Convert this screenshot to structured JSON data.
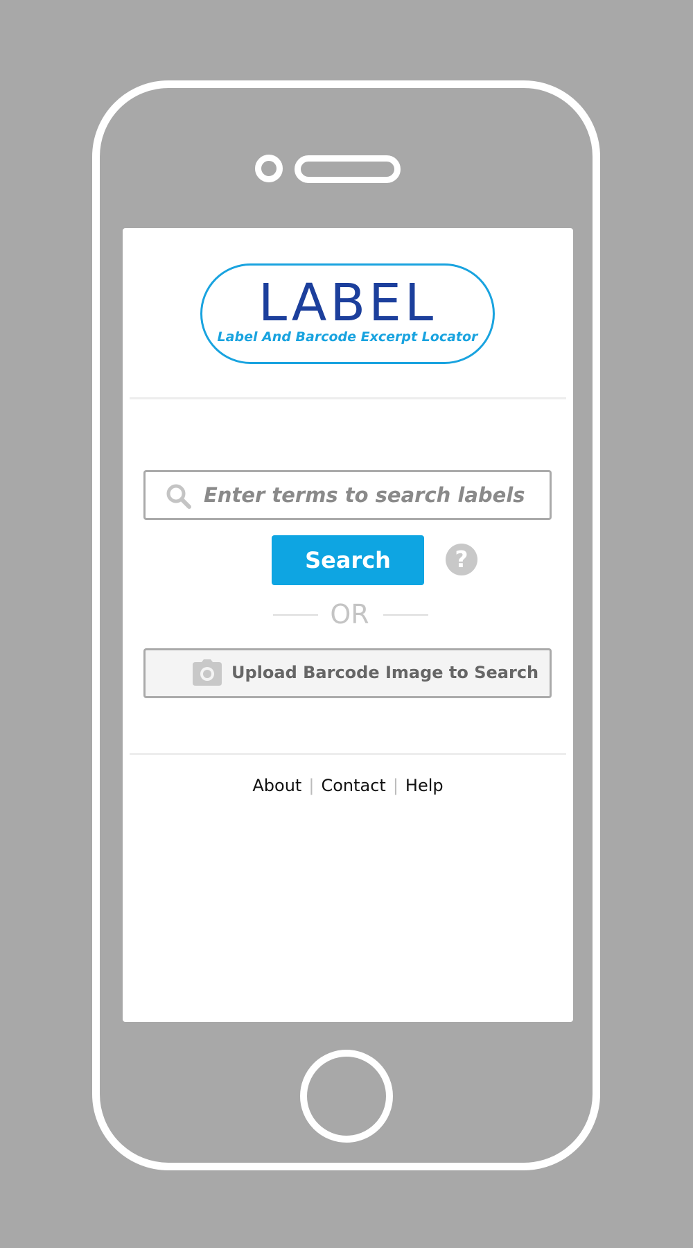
{
  "logo": {
    "title": "LABEL",
    "subtitle": "Label And Barcode Excerpt Locator"
  },
  "search": {
    "placeholder": "Enter terms to search labels",
    "value": "",
    "button_label": "Search",
    "help_icon": "question-mark-icon",
    "help_glyph": "?"
  },
  "separator": {
    "label": "OR"
  },
  "upload": {
    "icon": "camera-icon",
    "label": "Upload Barcode Image to Search"
  },
  "footer": {
    "links": [
      "About",
      "Contact",
      "Help"
    ],
    "separator": "|"
  },
  "colors": {
    "background": "#a8a8a8",
    "phone_outline": "#ffffff",
    "accent": "#0ea5e2",
    "logo_dark": "#1c3f9c",
    "logo_light": "#19a3df"
  }
}
